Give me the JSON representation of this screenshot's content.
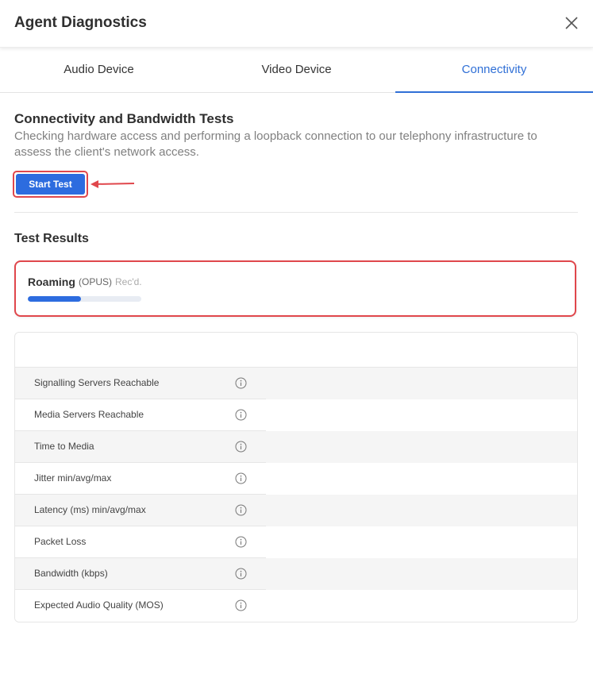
{
  "dialog": {
    "title": "Agent Diagnostics",
    "close_icon": "close-icon"
  },
  "tabs": [
    {
      "label": "Audio Device",
      "active": false
    },
    {
      "label": "Video Device",
      "active": false
    },
    {
      "label": "Connectivity",
      "active": true
    }
  ],
  "section": {
    "title": "Connectivity and Bandwidth Tests",
    "description": "Checking hardware access and performing a loopback connection to our telephony infrastructure to assess the client's network access.",
    "start_button": "Start Test"
  },
  "results": {
    "title": "Test Results",
    "roaming": {
      "name": "Roaming",
      "codec": "(OPUS)",
      "status": "Rec'd.",
      "progress": 0.47
    },
    "rows": [
      {
        "label": "Signalling Servers Reachable"
      },
      {
        "label": "Media Servers Reachable"
      },
      {
        "label": "Time to Media"
      },
      {
        "label": "Jitter min/avg/max"
      },
      {
        "label": "Latency (ms) min/avg/max"
      },
      {
        "label": "Packet Loss"
      },
      {
        "label": "Bandwidth (kbps)"
      },
      {
        "label": "Expected Audio Quality (MOS)"
      }
    ]
  },
  "colors": {
    "accent": "#2d6cdf",
    "tab_active": "#2f6fd6",
    "highlight": "#e0474c"
  }
}
